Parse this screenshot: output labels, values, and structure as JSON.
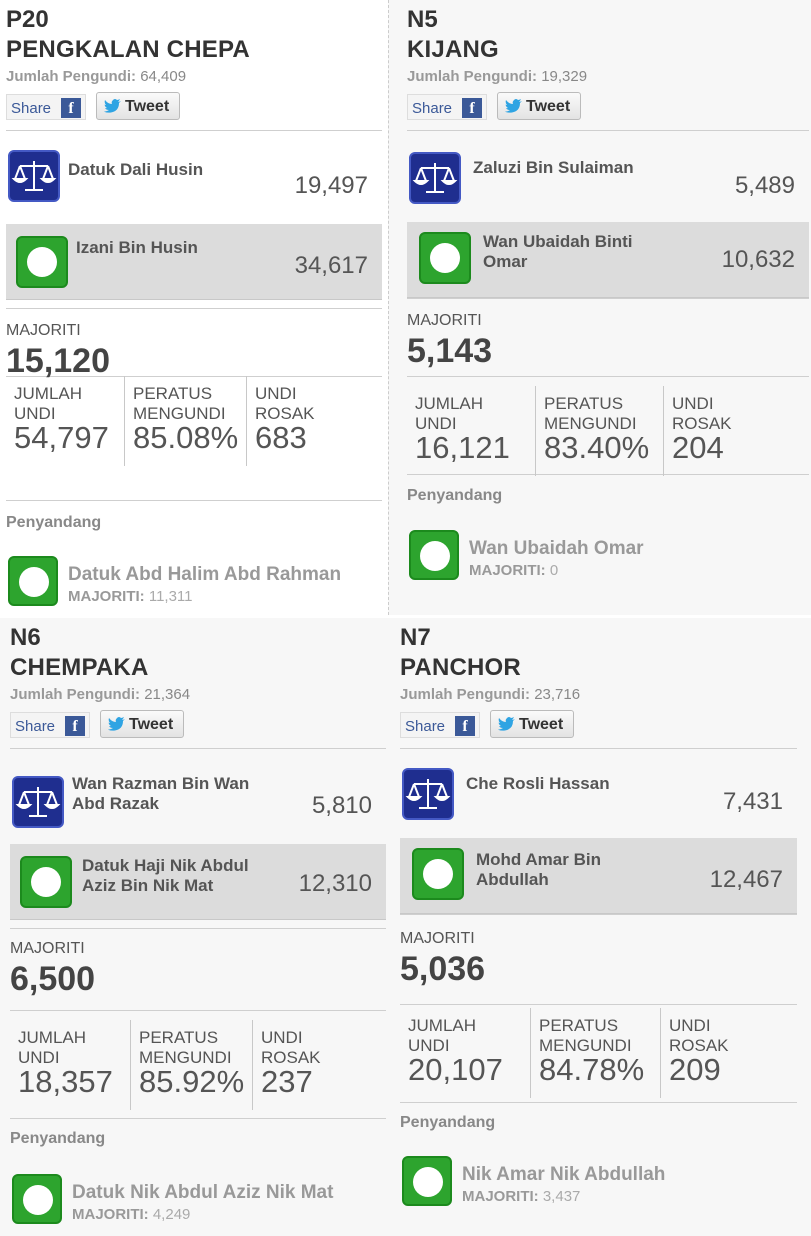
{
  "share_label": "Share",
  "tweet_label": "Tweet",
  "voters_label": "Jumlah Pengundi:",
  "majority_label": "MAJORITI",
  "incumbent_label": "Penyandang",
  "stats_labels": {
    "total": [
      "JUMLAH",
      "UNDI"
    ],
    "percent": [
      "PERATUS",
      "MENGUNDI"
    ],
    "spoilt": [
      "UNDI",
      "ROSAK"
    ]
  },
  "inc_majority_label": "MAJORITI:",
  "colors": {
    "bn": "#1f2e8f",
    "pas": "#2da42e",
    "facebook": "#3b5998",
    "twitter": "#2fa4e3"
  },
  "icons": [
    "facebook-icon",
    "twitter-bird-icon",
    "bn-scales-logo-icon",
    "pas-moon-logo-icon"
  ],
  "cards": [
    {
      "code": "P20",
      "name": "PENGKALAN CHEPA",
      "voters": "64,409",
      "candidates": [
        {
          "name_lines": [
            "Datuk Dali Husin"
          ],
          "votes": "19,497",
          "party": "bn",
          "winner": false
        },
        {
          "name_lines": [
            "Izani Bin Husin"
          ],
          "votes": "34,617",
          "party": "pas",
          "winner": true
        }
      ],
      "majority": "15,120",
      "stats": {
        "total": "54,797",
        "percent": "85.08%",
        "spoilt": "683"
      },
      "incumbent": {
        "name": "Datuk Abd Halim Abd Rahman",
        "majority": "11,311"
      }
    },
    {
      "code": "N5",
      "name": "KIJANG",
      "voters": "19,329",
      "candidates": [
        {
          "name_lines": [
            "Zaluzi Bin Sulaiman"
          ],
          "votes": "5,489",
          "party": "bn",
          "winner": false
        },
        {
          "name_lines": [
            "Wan Ubaidah Binti",
            "Omar"
          ],
          "votes": "10,632",
          "party": "pas",
          "winner": true
        }
      ],
      "majority": "5,143",
      "stats": {
        "total": "16,121",
        "percent": "83.40%",
        "spoilt": "204"
      },
      "incumbent": {
        "name": "Wan Ubaidah Omar",
        "majority": "0"
      }
    },
    {
      "code": "N6",
      "name": "CHEMPAKA",
      "voters": "21,364",
      "candidates": [
        {
          "name_lines": [
            "Wan Razman Bin Wan",
            "Abd Razak"
          ],
          "votes": "5,810",
          "party": "bn",
          "winner": false
        },
        {
          "name_lines": [
            "Datuk Haji Nik Abdul",
            "Aziz Bin Nik Mat"
          ],
          "votes": "12,310",
          "party": "pas",
          "winner": true
        }
      ],
      "majority": "6,500",
      "stats": {
        "total": "18,357",
        "percent": "85.92%",
        "spoilt": "237"
      },
      "incumbent": {
        "name": "Datuk Nik Abdul Aziz Nik Mat",
        "majority": "4,249"
      }
    },
    {
      "code": "N7",
      "name": "PANCHOR",
      "voters": "23,716",
      "candidates": [
        {
          "name_lines": [
            "Che Rosli Hassan"
          ],
          "votes": "7,431",
          "party": "bn",
          "winner": false
        },
        {
          "name_lines": [
            "Mohd Amar Bin",
            "Abdullah"
          ],
          "votes": "12,467",
          "party": "pas",
          "winner": true
        }
      ],
      "majority": "5,036",
      "stats": {
        "total": "20,107",
        "percent": "84.78%",
        "spoilt": "209"
      },
      "incumbent": {
        "name": "Nik Amar Nik Abdullah",
        "majority": "3,437"
      }
    }
  ]
}
